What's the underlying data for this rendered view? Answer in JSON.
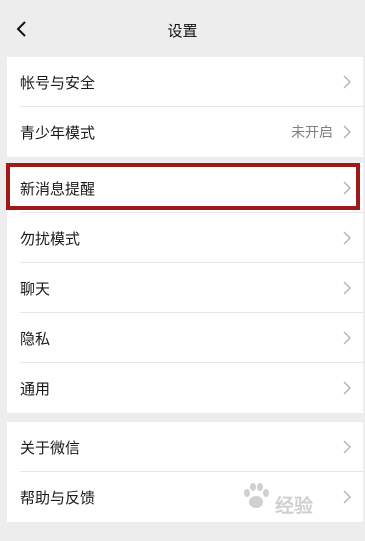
{
  "header": {
    "title": "设置"
  },
  "groups": [
    {
      "items": [
        {
          "label": "帐号与安全",
          "value": ""
        },
        {
          "label": "青少年模式",
          "value": "未开启"
        }
      ]
    },
    {
      "items": [
        {
          "label": "新消息提醒",
          "value": ""
        },
        {
          "label": "勿扰模式",
          "value": ""
        },
        {
          "label": "聊天",
          "value": ""
        },
        {
          "label": "隐私",
          "value": ""
        },
        {
          "label": "通用",
          "value": ""
        }
      ]
    },
    {
      "items": [
        {
          "label": "关于微信",
          "value": ""
        },
        {
          "label": "帮助与反馈",
          "value": ""
        }
      ]
    }
  ],
  "icons": {
    "back": "chevron-left-icon",
    "row": "chevron-right-icon"
  },
  "colors": {
    "highlight": "#a01818"
  },
  "watermark": {
    "text": "经验"
  }
}
